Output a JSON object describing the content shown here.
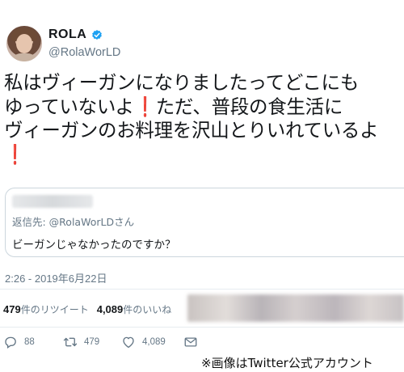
{
  "author": {
    "display_name": "ROLA",
    "handle": "@RolaWorLD",
    "verified": true
  },
  "tweet": {
    "lines": [
      [
        "私はヴィーガンになりましたってどこにも",
        ""
      ],
      [
        "ゆっていないよ",
        "ただ、普段の食生活に"
      ],
      [
        "ヴィーガンのお料理を沢山とりいれているよ",
        ""
      ]
    ],
    "emoji": "heavy-exclamation-mark"
  },
  "quoted_tweet": {
    "reply_to": "返信先: @RolaWorLDさん",
    "text": "ビーガンじゃなかったのですか？"
  },
  "timestamp": "2:26 - 2019年6月22日",
  "stats": {
    "retweets_count": "479",
    "retweets_label": "件のリツイート",
    "likes_count": "4,089",
    "likes_label": "件のいいね"
  },
  "actions": {
    "reply_count": "88",
    "retweet_count": "479",
    "like_count": "4,089"
  },
  "credit": "※画像はTwitter公式アカウント",
  "colors": {
    "text": "#14171a",
    "secondary": "#657786",
    "verified": "#1da1f2",
    "emoji_red": "#d21d3c",
    "border": "#e6ecf0"
  }
}
